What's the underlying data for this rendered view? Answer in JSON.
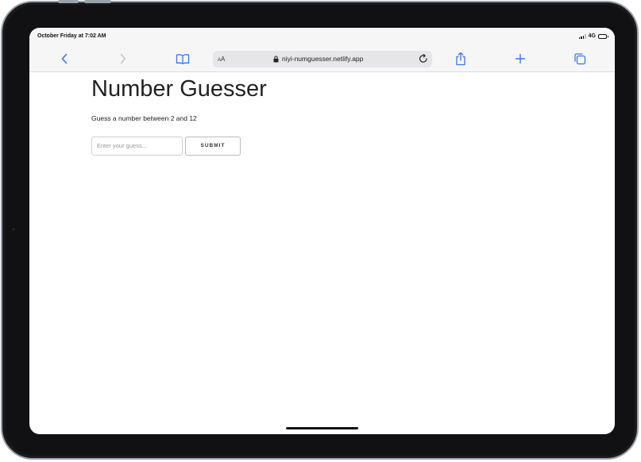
{
  "status_bar": {
    "time": "October Friday at 7:02 AM",
    "network": "4G"
  },
  "toolbar": {
    "aa_small": "A",
    "aa_large": "A",
    "url": "niyi-numguesser.netlify.app"
  },
  "page": {
    "title": "Number Guesser",
    "subtitle": "Guess a number between 2 and 12",
    "input_placeholder": "Enter your guess...",
    "input_value": "",
    "submit_label": "SUBMIT"
  },
  "colors": {
    "accent": "#3478f6",
    "accent_disabled": "#c4c4c8"
  },
  "icons": [
    "back-icon",
    "forward-icon",
    "bookmarks-icon",
    "lock-icon",
    "reload-icon",
    "share-icon",
    "new-tab-icon",
    "tabs-icon",
    "signal-icon",
    "battery-icon"
  ]
}
